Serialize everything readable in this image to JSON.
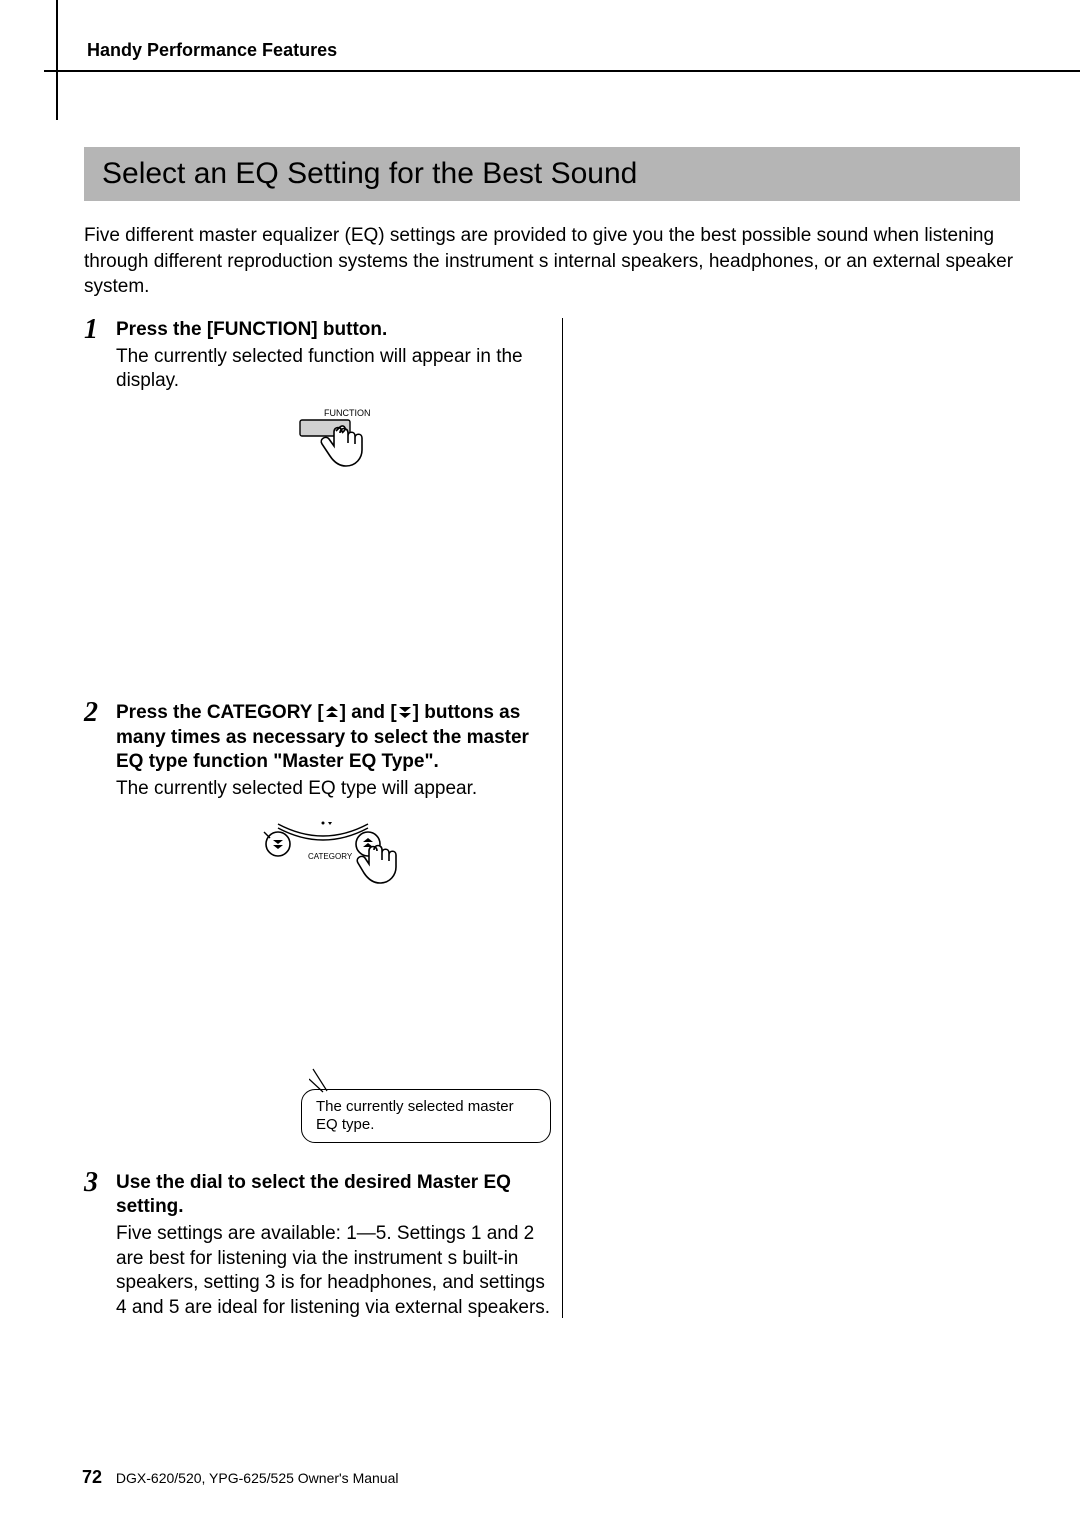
{
  "header": {
    "section": "Handy Performance Features"
  },
  "title": "Select an EQ Setting for the Best Sound",
  "intro": "Five different master equalizer (EQ) settings are provided to give you the best possible sound when listening through different reproduction systems the instrument s internal speakers, headphones, or an external speaker system.",
  "steps": [
    {
      "num": "1",
      "head": "Press the [FUNCTION] button.",
      "body": "The currently selected function will appear in the display.",
      "button_label": "FUNCTION"
    },
    {
      "num": "2",
      "head_pre": "Press the CATEGORY [",
      "head_mid": "] and [",
      "head_post": "] buttons as many times as necessary to select the master EQ type function \"Master EQ Type\".",
      "body": "The currently selected EQ type will appear.",
      "panel_label": "CATEGORY"
    },
    {
      "num": "3",
      "head": "Use the dial to select the desired Master EQ setting.",
      "body": "Five settings are available: 1—5. Settings 1 and 2 are best for listening via the instrument s built-in speakers, setting 3 is for headphones, and settings 4 and 5 are ideal for listening via external speakers."
    }
  ],
  "callout": "The currently selected master EQ type.",
  "footer": {
    "page": "72",
    "manual": "DGX-620/520, YPG-625/525  Owner's Manual"
  }
}
